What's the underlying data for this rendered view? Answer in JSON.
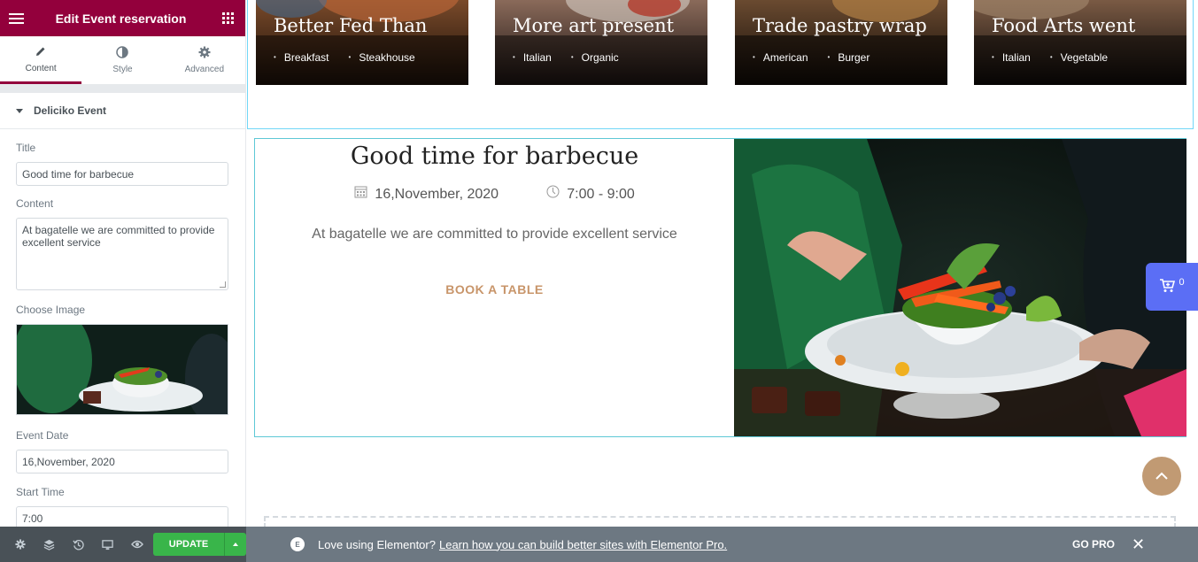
{
  "panel": {
    "title": "Edit Event reservation",
    "tabs": [
      {
        "label": "Content",
        "icon": "pencil-icon"
      },
      {
        "label": "Style",
        "icon": "half-circle-icon"
      },
      {
        "label": "Advanced",
        "icon": "gear-icon"
      }
    ],
    "section_title": "Deliciko Event",
    "fields": {
      "title_label": "Title",
      "title_value": "Good time for barbecue",
      "content_label": "Content",
      "content_value": "At bagatelle we are committed to provide excellent service",
      "image_label": "Choose Image",
      "date_label": "Event Date",
      "date_value": "16,November, 2020",
      "start_label": "Start Time",
      "start_value": "7:00"
    },
    "footer": {
      "update_label": "UPDATE"
    }
  },
  "cards": [
    {
      "title": "Better Fed Than",
      "tags": [
        "Breakfast",
        "Steakhouse"
      ]
    },
    {
      "title": "More art present",
      "tags": [
        "Italian",
        "Organic"
      ]
    },
    {
      "title": "Trade pastry wrap",
      "tags": [
        "American",
        "Burger"
      ]
    },
    {
      "title": "Food Arts went",
      "tags": [
        "Italian",
        "Vegetable"
      ]
    }
  ],
  "event": {
    "title": "Good time for barbecue",
    "date": "16,November, 2020",
    "time": "7:00 - 9:00",
    "description": "At bagatelle we are committed to provide excellent service",
    "cta": "BOOK A TABLE"
  },
  "cart": {
    "count": "0"
  },
  "promo": {
    "text": "Love using Elementor?",
    "link": "Learn how you can build better sites with Elementor Pro.",
    "gopro": "GO PRO"
  },
  "colors": {
    "brand": "#93003c",
    "update_green": "#39b54a",
    "accent_gold": "#c8956a",
    "cart_blue": "#5b6ef5"
  }
}
